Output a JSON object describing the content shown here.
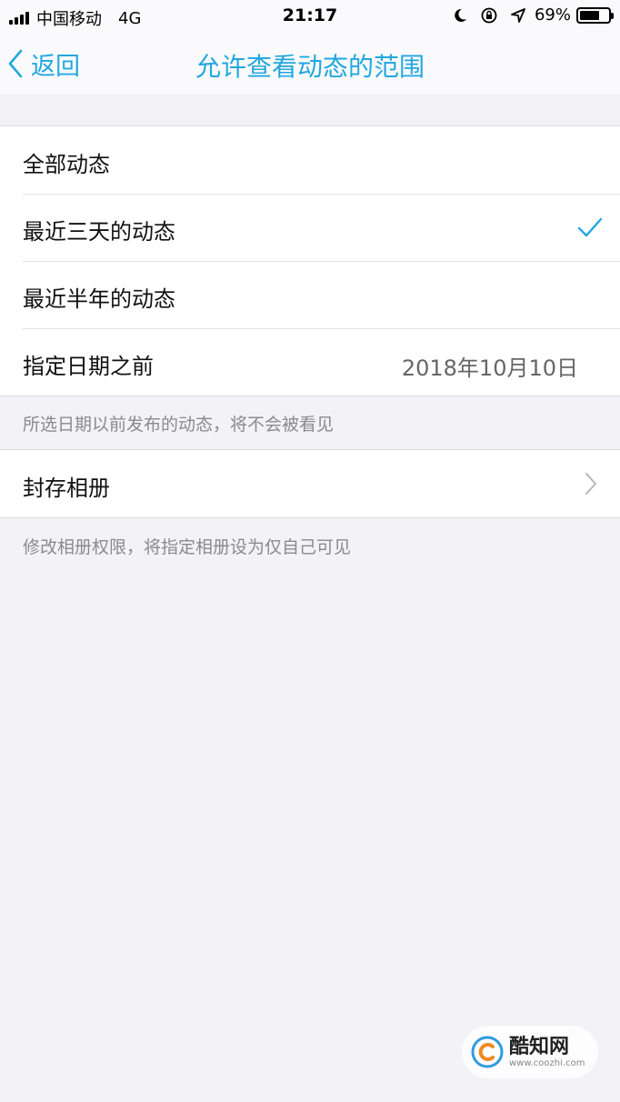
{
  "status_bar": {
    "carrier": "中国移动",
    "network": "4G",
    "time": "21:17",
    "battery_percent": "69%",
    "battery_level": 0.69,
    "icons": [
      "moon-icon",
      "rotation-lock-icon",
      "location-icon"
    ]
  },
  "nav": {
    "back_label": "返回",
    "title": "允许查看动态的范围"
  },
  "options": [
    {
      "label": "全部动态",
      "selected": false
    },
    {
      "label": "最近三天的动态",
      "selected": true
    },
    {
      "label": "最近半年的动态",
      "selected": false
    },
    {
      "label": "指定日期之前",
      "value": "2018年10月10日",
      "selected": false
    }
  ],
  "options_footnote": "所选日期以前发布的动态，将不会被看见",
  "archive": {
    "label": "封存相册",
    "footnote": "修改相册权限，将指定相册设为仅自己可见"
  },
  "watermark": {
    "name": "酷知网",
    "url": "www.coozhi.com"
  },
  "colors": {
    "accent": "#22a7e0",
    "background": "#f2f2f7"
  }
}
